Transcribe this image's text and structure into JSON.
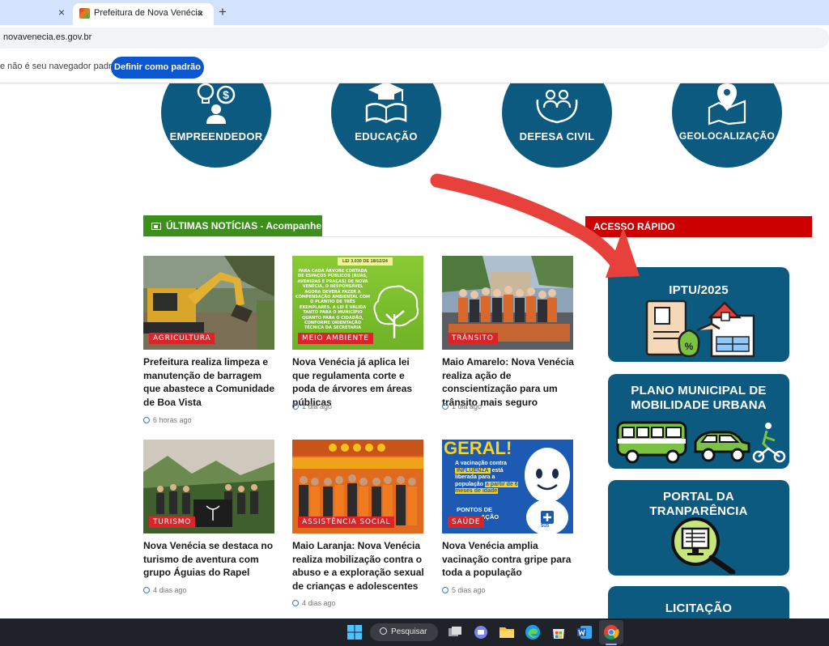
{
  "browser": {
    "active_tab_title": "Prefeitura de Nova Venécia",
    "close_glyph": "×",
    "newtab_glyph": "+",
    "url": "novavenecia.es.gov.br",
    "infobar_text": "e não é seu navegador padrão",
    "infobar_button": "Definir como padrão"
  },
  "categories": [
    {
      "label": "EMPREENDEDOR",
      "icon": "entrepreneur-icon"
    },
    {
      "label": "EDUCAÇÃO",
      "icon": "graduation-book-icon"
    },
    {
      "label": "DEFESA CIVIL",
      "icon": "protecting-hands-icon"
    },
    {
      "label": "GEOLOCALIZAÇÃO",
      "icon": "map-pin-icon"
    }
  ],
  "news": {
    "header": "ÚLTIMAS NOTÍCIAS - Acompanhe",
    "items": [
      {
        "tag": "AGRICULTURA",
        "title": "Prefeitura realiza limpeza e manutenção de barragem que abastece a Comunidade de Boa Vista",
        "date": "6 horas ago"
      },
      {
        "tag": "MEIO AMBIENTE",
        "title": "Nova Venécia já aplica lei que regulamenta corte e poda de árvores em áreas públicas",
        "date": "1 dia ago",
        "image_text": {
          "top": "LEI 3.030 DE 18/12/24",
          "body": "PARA CADA ÁRVORE CORTADA DE ESPAÇOS PÚBLICOS (RUAS, AVENIDAS E PRAÇAS) DE NOVA VENÉCIA, O RESPONSÁVEL AGORA DEVERÁ FAZER A COMPENSAÇÃO AMBIENTAL COM O PLANTIO DE TRÊS EXEMPLARES. A LEI É VÁLIDA TANTO PARA O MUNICÍPIO QUANTO PARA O CIDADÃO, CONFORME ORIENTAÇÃO TÉCNICA DA SECRETARIA"
        }
      },
      {
        "tag": "TRÂNSITO",
        "title": "Maio Amarelo: Nova Venécia realiza ação de conscientização para um trânsito mais seguro",
        "date": "1 dia ago"
      },
      {
        "tag": "TURISMO",
        "title": "Nova Venécia se destaca no turismo de aventura com grupo Águias do Rapel",
        "date": "4 dias ago"
      },
      {
        "tag": "ASSISTÊNCIA SOCIAL",
        "title": "Maio Laranja: Nova Venécia realiza mobilização contra o abuso e a exploração sexual de crianças e adolescentes",
        "date": "4 dias ago"
      },
      {
        "tag": "SAÚDE",
        "title": "Nova Venécia amplia vacinação contra gripe para toda a população",
        "date": "5 dias ago",
        "image_text": {
          "headline": "GERAL!",
          "line1": "A vacinação contra",
          "highlight": "INFLUENZA",
          "line2": "está",
          "line3": "liberada para a",
          "line4": "população",
          "line5": "a partir de 6 meses de idade",
          "line6": "PONTOS DE",
          "line7": "AÇÃO",
          "badge": "SUS"
        }
      }
    ]
  },
  "quick_access": {
    "header": "ACESSO RÁPIDO",
    "items": [
      {
        "title": "IPTU/2025",
        "icon": "tax-documents-icon"
      },
      {
        "title": "PLANO MUNICIPAL DE MOBILIDADE URBANA",
        "icon": "bus-car-bike-icon"
      },
      {
        "title": "PORTAL DA TRANPARÊNCIA",
        "icon": "magnifier-monitor-icon"
      },
      {
        "title": "LICITAÇÃO",
        "icon": "tender-icon"
      }
    ]
  },
  "taskbar": {
    "search_label": "Pesquisar"
  },
  "colors": {
    "circle_blue": "#0d5a80",
    "news_green": "#3b8f1a",
    "acesso_red": "#cc0000",
    "tag_red": "#d9252a",
    "arrow_red": "#e8403a"
  }
}
